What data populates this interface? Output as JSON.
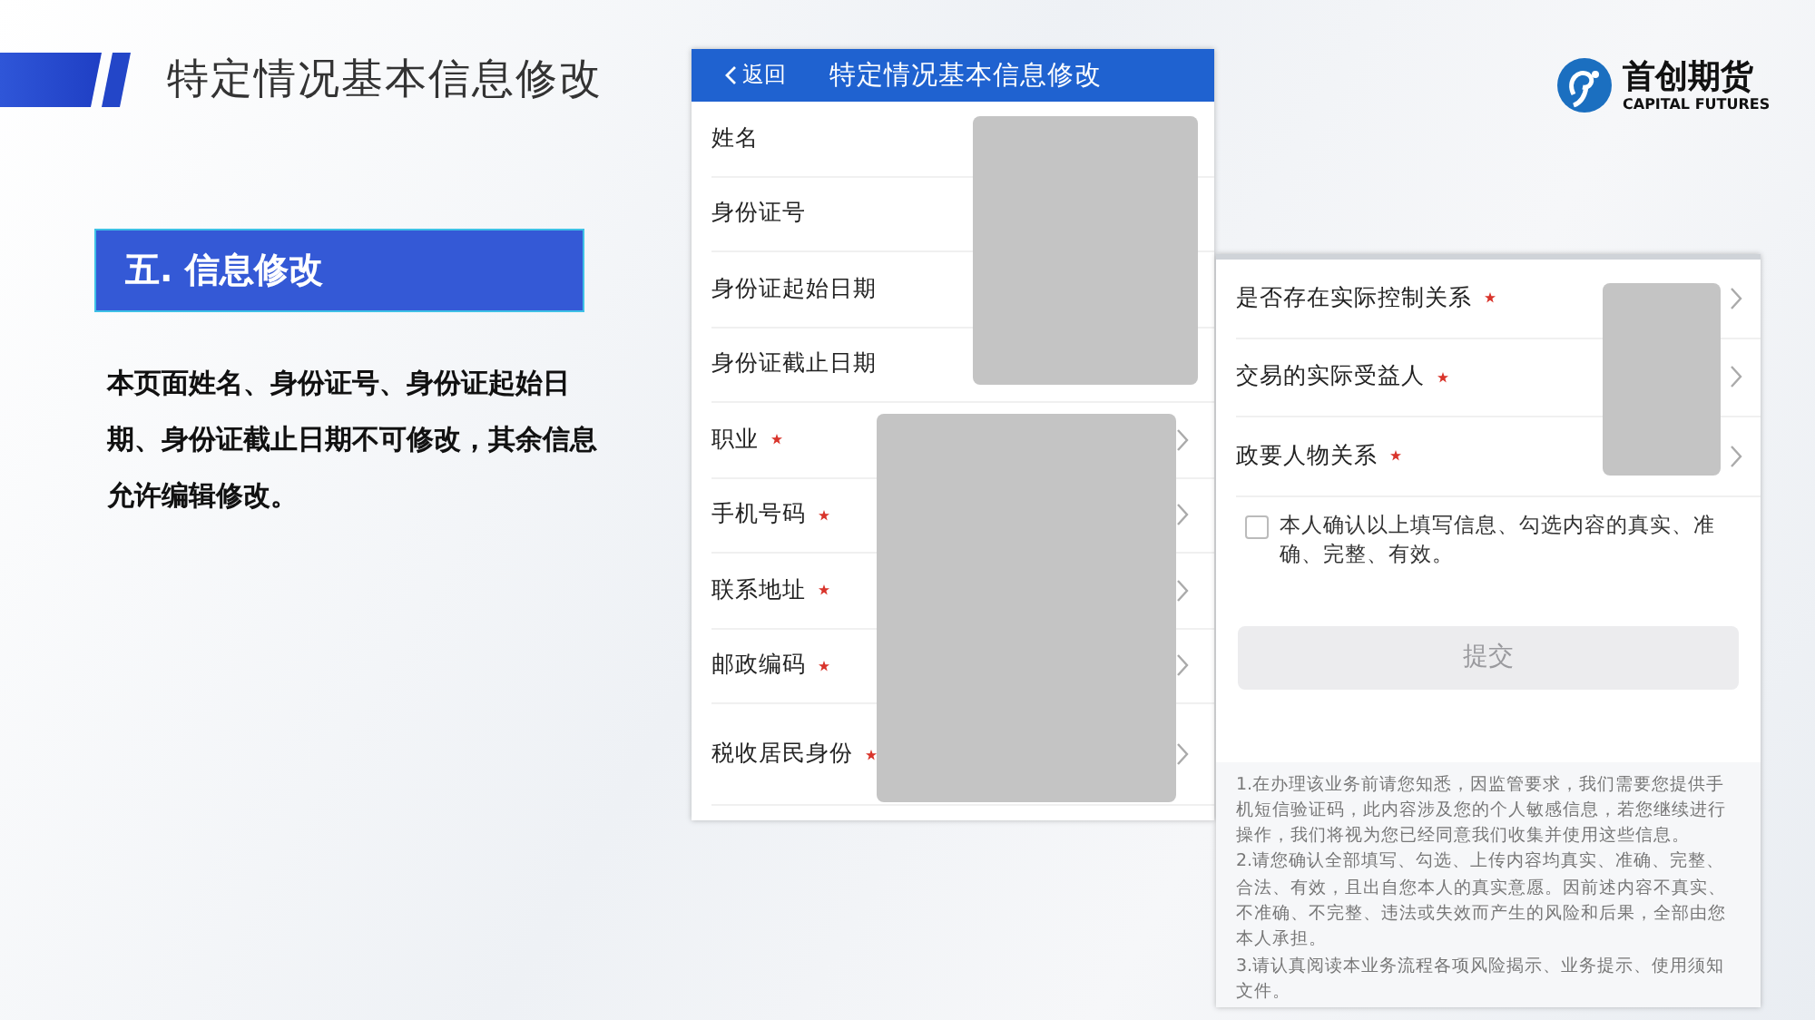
{
  "slide": {
    "title": "特定情况基本信息修改",
    "section_heading": "五. 信息修改",
    "description": "本页面姓名、身份证号、身份证起始日期、身份证截止日期不可修改，其余信息允许编辑修改。"
  },
  "logo": {
    "name": "首创期货",
    "subtitle": "CAPITAL FUTURES"
  },
  "screen_1": {
    "back": "返回",
    "title": "特定情况基本信息修改",
    "rows": [
      {
        "label": "姓名",
        "required": false,
        "arrow": false
      },
      {
        "label": "身份证号",
        "required": false,
        "arrow": false
      },
      {
        "label": "身份证起始日期",
        "required": false,
        "arrow": false
      },
      {
        "label": "身份证截止日期",
        "required": false,
        "arrow": false
      },
      {
        "label": "职业",
        "required": true,
        "arrow": true
      },
      {
        "label": "手机号码",
        "required": true,
        "arrow": true
      },
      {
        "label": "联系地址",
        "required": true,
        "arrow": true
      },
      {
        "label": "邮政编码",
        "required": true,
        "arrow": true
      },
      {
        "label": "税收居民身份",
        "required": true,
        "arrow": true
      }
    ]
  },
  "screen_2": {
    "rows": [
      {
        "label": "是否存在实际控制关系",
        "required": true,
        "arrow": true
      },
      {
        "label": "交易的实际受益人",
        "required": true,
        "arrow": true
      },
      {
        "label": "政要人物关系",
        "required": true,
        "arrow": true
      }
    ],
    "confirm": {
      "text": "本人确认以上填写信息、勾选内容的真实、准确、完整、有效。",
      "checked": false
    },
    "submit": {
      "label": "提交",
      "disabled": true
    },
    "notes": [
      "1.在办理该业务前请您知悉，因监管要求，我们需要您提供手机短信验证码，此内容涉及您的个人敏感信息，若您继续进行操作，我们将视为您已经同意我们收集并使用这些信息。",
      "2.请您确认全部填写、勾选、上传内容均真实、准确、完整、合法、有效，且出自您本人的真实意愿。因前述内容不真实、不准确、不完整、违法或失效而产生的风险和后果，全部由您本人承担。",
      "3.请认真阅读本业务流程各项风险揭示、业务提示、使用须知文件。"
    ]
  }
}
